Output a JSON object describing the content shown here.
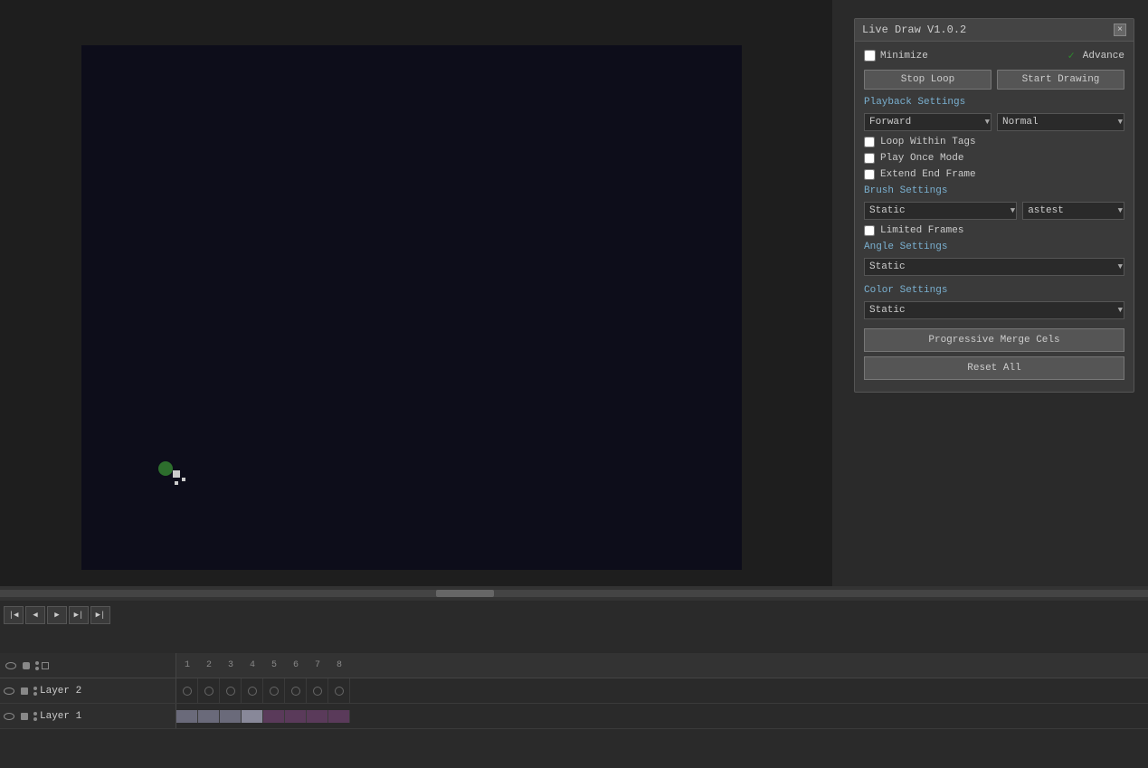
{
  "panel": {
    "title": "Live Draw V1.0.2",
    "close_label": "×",
    "minimize_label": "Minimize",
    "advance_label": "Advance",
    "advance_checked": true,
    "stop_loop_label": "Stop Loop",
    "start_drawing_label": "Start Drawing",
    "playback_settings_label": "Playback Settings",
    "playback_direction": "Forward",
    "playback_speed": "Normal",
    "loop_within_tags_label": "Loop Within Tags",
    "play_once_mode_label": "Play Once Mode",
    "extend_end_frame_label": "Extend End Frame",
    "brush_settings_label": "Brush Settings",
    "brush_type": "Static",
    "brush_preset": "astest",
    "limited_frames_label": "Limited Frames",
    "angle_settings_label": "Angle Settings",
    "angle_type": "Static",
    "color_settings_label": "Color Settings",
    "color_type": "Static",
    "progressive_merge_label": "Progressive Merge Cels",
    "reset_all_label": "Reset All"
  },
  "timeline": {
    "frame_numbers": [
      "1",
      "2",
      "3",
      "4",
      "5",
      "6",
      "7",
      "8"
    ],
    "layers": [
      {
        "name": "Layer 2",
        "visible": true,
        "locked": false
      },
      {
        "name": "Layer 1",
        "visible": true,
        "locked": false
      }
    ]
  },
  "transport": {
    "buttons": [
      "⏮",
      "◀◀",
      "▶",
      "▶▶",
      "⏭"
    ]
  }
}
